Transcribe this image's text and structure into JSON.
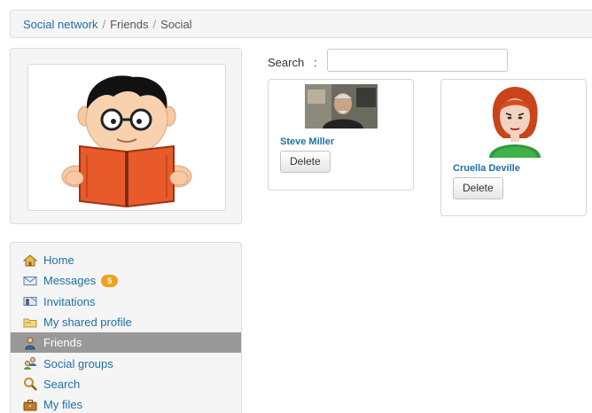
{
  "breadcrumb": {
    "items": [
      "Social network",
      "Friends",
      "Social"
    ],
    "separator": "/"
  },
  "search": {
    "label": "Search",
    "colon": ":",
    "value": "",
    "placeholder": ""
  },
  "menu": {
    "items": [
      {
        "label": "Home",
        "icon": "home-icon"
      },
      {
        "label": "Messages",
        "icon": "envelope-icon",
        "badge": "5"
      },
      {
        "label": "Invitations",
        "icon": "invitation-icon"
      },
      {
        "label": "My shared profile",
        "icon": "folder-icon"
      },
      {
        "label": "Friends",
        "icon": "user-icon",
        "active": true
      },
      {
        "label": "Social groups",
        "icon": "group-icon"
      },
      {
        "label": "Search",
        "icon": "magnifier-icon"
      },
      {
        "label": "My files",
        "icon": "briefcase-icon"
      }
    ]
  },
  "friends": [
    {
      "name": "Steve Miller",
      "photo": "man-photo",
      "action": "Delete"
    },
    {
      "name": "Cruella Deville",
      "photo": "woman-avatar",
      "action": "Delete"
    }
  ],
  "colors": {
    "link": "#1f6fa8",
    "active_menu": "#999999",
    "badge": "#f0a11c"
  }
}
